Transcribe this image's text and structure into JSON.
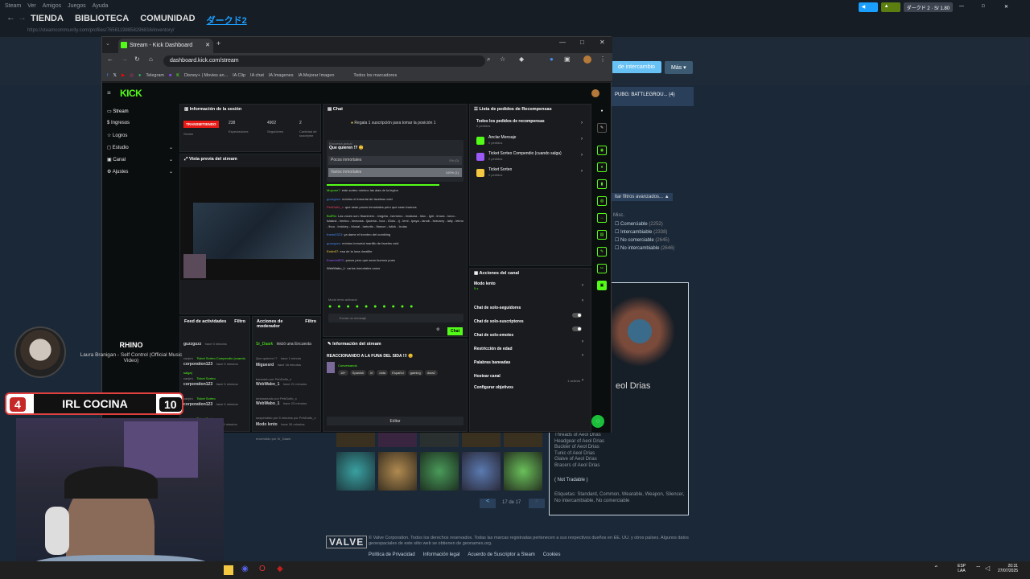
{
  "steam": {
    "menu": [
      "Steam",
      "Ver",
      "Amigos",
      "Juegos",
      "Ayuda"
    ],
    "nav": [
      "TIENDA",
      "BIBLIOTECA",
      "COMUNIDAD",
      "ダークド2"
    ],
    "url": "https://steamcommunity.com/profiles/76561198858296816/inventory/",
    "user": "ダークド 2",
    "user_balance": "S/ 1.80",
    "exchange_btn": "de intercambio",
    "more_btn": "Más",
    "game_tab": "PUBG: BATTLEGROU...",
    "game_count": "(4)",
    "advanced_filters": "ltar filtros avanzados...",
    "misc": "Misc.",
    "filters": [
      {
        "label": "Comerciable",
        "count": "(2252)"
      },
      {
        "label": "Intercambiable",
        "count": "(2338)"
      },
      {
        "label": "No comerciable",
        "count": "(2645)"
      },
      {
        "label": "No intercambiable",
        "count": "(2646)"
      }
    ],
    "item_name": "eol Drias",
    "item_set": [
      "Threads of Aeol Drias",
      "Headgear of Aeol Drias",
      "Buckler of Aeol Drias",
      "Tunic of Aeol Drias",
      "Glaive of Aeol Drias",
      "Bracers of Aeol Drias"
    ],
    "not_tradable": "( Not Tradable )",
    "tags": "Etiquetas: Standard, Common, Wearable, Weapon, Silencer, No intercambiable, No comerciable",
    "pager": "17 de 17",
    "footer_text": "© Valve Corporation. Todos los derechos reservados. Todas las marcas registradas pertenecen a sus respectivos dueños en EE. UU. y otros países. Algunos datos geoespaciales de este sitio web se obtienen de geonames.org.",
    "footer_links": [
      "Política de Privacidad",
      "Información legal",
      "Acuerdo de Suscriptor a Steam",
      "Cookies"
    ],
    "valve": "VALVE"
  },
  "browser": {
    "tab_title": "Stream - Kick Dashboard",
    "url": "dashboard.kick.com/stream",
    "bookmarks": [
      "Telegram",
      "Disney+ | Movies an...",
      "IA Clip",
      "IA chat",
      "IA Imagenes",
      "IA Mejorar Imagen",
      "Todos los marcadores"
    ]
  },
  "kick": {
    "logo": "KICK",
    "sidebar": [
      "Stream",
      "Ingresos",
      "Logros",
      "Estudio",
      "Canal",
      "Ajustes"
    ],
    "session": {
      "title": "Información de la sesión",
      "live": "TRANSMITIENDO",
      "session_label": "Sesión",
      "viewers": "238",
      "viewers_label": "Espectadores",
      "followers": "4902",
      "followers_label": "Seguidores",
      "subs": "2",
      "subs_label": "Cantidad de suscriptor"
    },
    "preview_title": "Vista previa del stream",
    "feed": {
      "title": "Feed de actividades",
      "filter": "Filtro",
      "items": [
        {
          "user": "guzzguzz",
          "time": "hace 5 minutos",
          "action": "canjeó",
          "reward": "Ticket Sorteo Compendio (cuando salga)"
        },
        {
          "user": "corporation123",
          "time": "hace 5 minutos",
          "action": "canjeó",
          "reward": "Ticket Sorteo"
        },
        {
          "user": "corporation123",
          "time": "hace 5 minutos",
          "action": "canjeó",
          "reward": "Ticket Sorteo"
        },
        {
          "user": "corporation123",
          "time": "hace 5 minutos",
          "action": "canjeó",
          "reward": "Ticket Sorteo"
        },
        {
          "user": "bolivian_demo",
          "time": "hace 6 minutos",
          "action": "",
          "reward": ""
        }
      ]
    },
    "modactions": {
      "title": "Acciones de moderador",
      "filter": "Filtro",
      "items": [
        {
          "user": "Sr_Daark",
          "text": "inició una Encuesta",
          "sub": "Que quieren !?",
          "time": "hace 1 minuto"
        },
        {
          "user": "Miguesrd",
          "text": "hace 16 minutos",
          "sub": "baneado por PehDolfo_x",
          "time": ""
        },
        {
          "user": "WebWabo_1",
          "text": "hace 21 minutos",
          "sub": "desbaneado por PehDolfo_x",
          "time": ""
        },
        {
          "user": "WebWabo_1",
          "text": "hace 23 minutos",
          "sub": "suspendido por 5 minutos por PehDolfo_x",
          "time": ""
        },
        {
          "user": "Modo lento",
          "text": "hace 26 minutos",
          "sub": "encendido por Sr_Daark",
          "time": ""
        }
      ]
    },
    "chat": {
      "title": "Chat",
      "gift": "Regala 1 suscripción para tomar la posición 1",
      "poll_label": "Encuesta actual",
      "poll_q": "Que quieren !? 😊",
      "options": [
        {
          "label": "Pocos inmortales",
          "pct": "0% (0)",
          "value": 0
        },
        {
          "label": "Varios inmortales",
          "pct": "100% (1)",
          "value": 100
        }
      ],
      "messages": [
        {
          "user": "Moyoen?",
          "text": "este sorteo mínimo las alas de la legion"
        },
        {
          "user": "guzzguzz",
          "text": "mínimo el inmortal de faceless void"
        },
        {
          "user": "PehDolfo_x",
          "text": "que sean pocos inmortales pero que sean buenos"
        },
        {
          "user": "BotRix",
          "text": "Las voces son: ftsaninero - lvegeta - isemeno - lmakara - ldoc - lgirl - lmura - lorco - lsidarsi - lmelco - lmecoss - ljacinta - lvoz - lGolu - lj - lemi - lpaya - lanub - lvizcarry - lally - lelmo - lbuu - lmickey - ldonal - larturito - lfarson - lstick - lxolas"
        },
        {
          "user": "franto0323",
          "text": "ya dame el hombro del oomiking"
        },
        {
          "user": "guzzguzz",
          "text": "mínimo inmortal martillo de faceles void"
        },
        {
          "user": "Eckin97",
          "text": "esa de la luna dorallite"
        },
        {
          "user": "Eoandol870",
          "text": "pocos pero que sean buenos pues"
        },
        {
          "user": "WebWabo_1",
          "text": "varios inmortales caros"
        }
      ],
      "slow_mode": "Modo lento activado",
      "input_placeholder": "Enviar un mensaje",
      "send": "Chat"
    },
    "stream_info": {
      "title": "Información del stream",
      "stream_title": "REACCIONANDO A LA FUNA DEL SIDA !!! 😊",
      "category": "Conversando",
      "tags": [
        "18+",
        "Spanish",
        "irl",
        "dota",
        "Español",
        "gaming",
        "dota2"
      ],
      "edit": "Editar"
    },
    "rewards": {
      "title": "Lista de pedidos de Recompensas",
      "all": "Todos los pedidos de recompensas",
      "all_sub": "0 pedidos",
      "items": [
        {
          "name": "Anclar Mensaje",
          "sub": "0 pedidos",
          "color": "#53fc18"
        },
        {
          "name": "Ticket Sorteo Compendio (cuando salga)",
          "sub": "0 pedidos",
          "color": "#9b59f5"
        },
        {
          "name": "Ticket Sorteo",
          "sub": "0 pedidos",
          "color": "#f5c842"
        }
      ]
    },
    "channel_actions": {
      "title": "Acciones del canal",
      "items": [
        {
          "label": "Modo lento",
          "sub": "5 s",
          "ctrl": "chev"
        },
        {
          "label": "Chat de solo-seguidores",
          "sub": "",
          "ctrl": "chev"
        },
        {
          "label": "Chat de solo-suscriptores",
          "sub": "",
          "ctrl": "toggle"
        },
        {
          "label": "Chat de solo-emotes",
          "sub": "",
          "ctrl": "toggle"
        },
        {
          "label": "Restricción de edad",
          "sub": "",
          "ctrl": "chev"
        },
        {
          "label": "Palabras baneadas",
          "sub": "",
          "ctrl": "chev"
        },
        {
          "label": "Hostear canal",
          "sub": "",
          "ctrl": "none"
        },
        {
          "label": "Configurar objetivos",
          "sub": "1 activos",
          "ctrl": "chev"
        }
      ]
    }
  },
  "overlay": {
    "song_artist": "RHINO",
    "song_title": "Laura Branigan - Self Control (Official Music Video)",
    "score_left": "4",
    "score_label": "IRL COCINA",
    "score_right": "10"
  },
  "taskbar": {
    "lang": "ESP",
    "region": "LAA",
    "time": "20:31",
    "date": "27/07/2025"
  }
}
